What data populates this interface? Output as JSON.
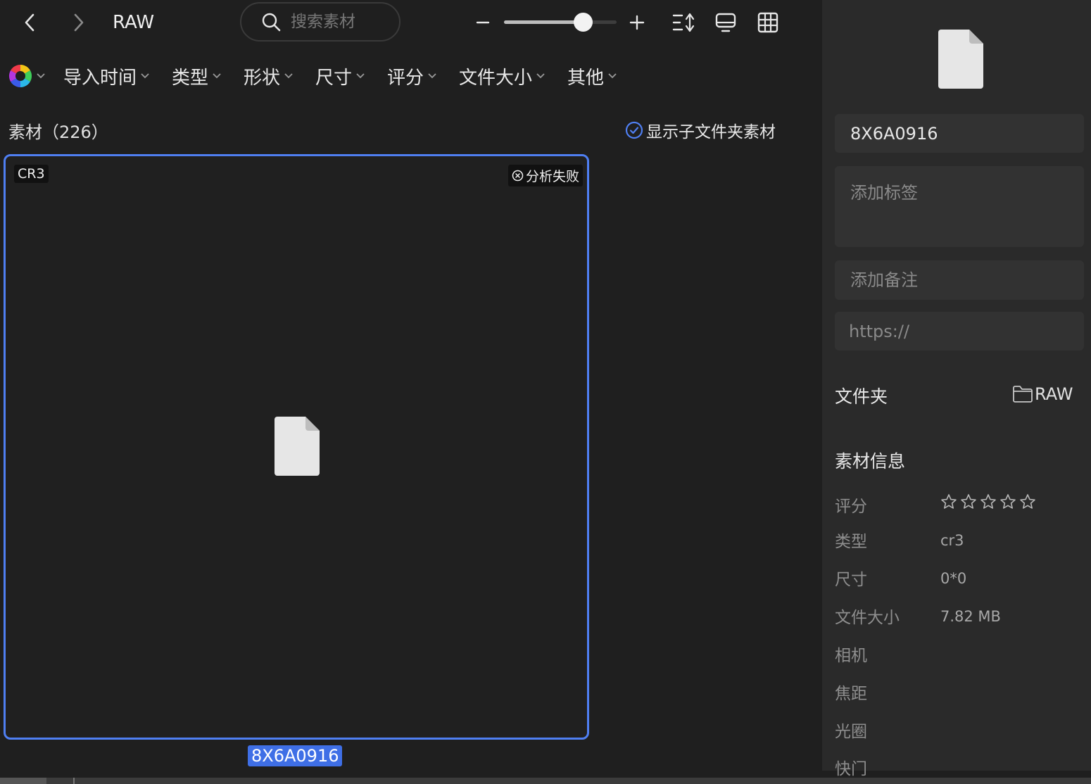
{
  "window": {
    "title": "RAW"
  },
  "search": {
    "placeholder": "搜索素材"
  },
  "zoom": {
    "level": 0.7
  },
  "filters": [
    {
      "label": "导入时间"
    },
    {
      "label": "类型"
    },
    {
      "label": "形状"
    },
    {
      "label": "尺寸"
    },
    {
      "label": "评分"
    },
    {
      "label": "文件大小"
    },
    {
      "label": "其他"
    }
  ],
  "list": {
    "count_label": "素材（226）",
    "subfolder_toggle_label": "显示子文件夹素材",
    "subfolder_toggle_checked": true
  },
  "card": {
    "ext_badge": "CR3",
    "status_badge": "分析失败",
    "file_name": "8X6A0916",
    "selected_color": "#4f7ff2"
  },
  "panel": {
    "name_value": "8X6A0916",
    "tags_placeholder": "添加标签",
    "note_placeholder": "添加备注",
    "url_placeholder": "https://",
    "folder_label": "文件夹",
    "folder_value": "RAW",
    "info_title": "素材信息",
    "info": {
      "rating_label": "评分",
      "rating_value": 0,
      "rating_max": 5,
      "type_label": "类型",
      "type_value": "cr3",
      "size_label": "尺寸",
      "size_value": "0*0",
      "filesize_label": "文件大小",
      "filesize_value": "7.82 MB",
      "camera_label": "相机",
      "focal_label": "焦距",
      "aperture_label": "光圈",
      "shutter_label": "快门"
    }
  }
}
